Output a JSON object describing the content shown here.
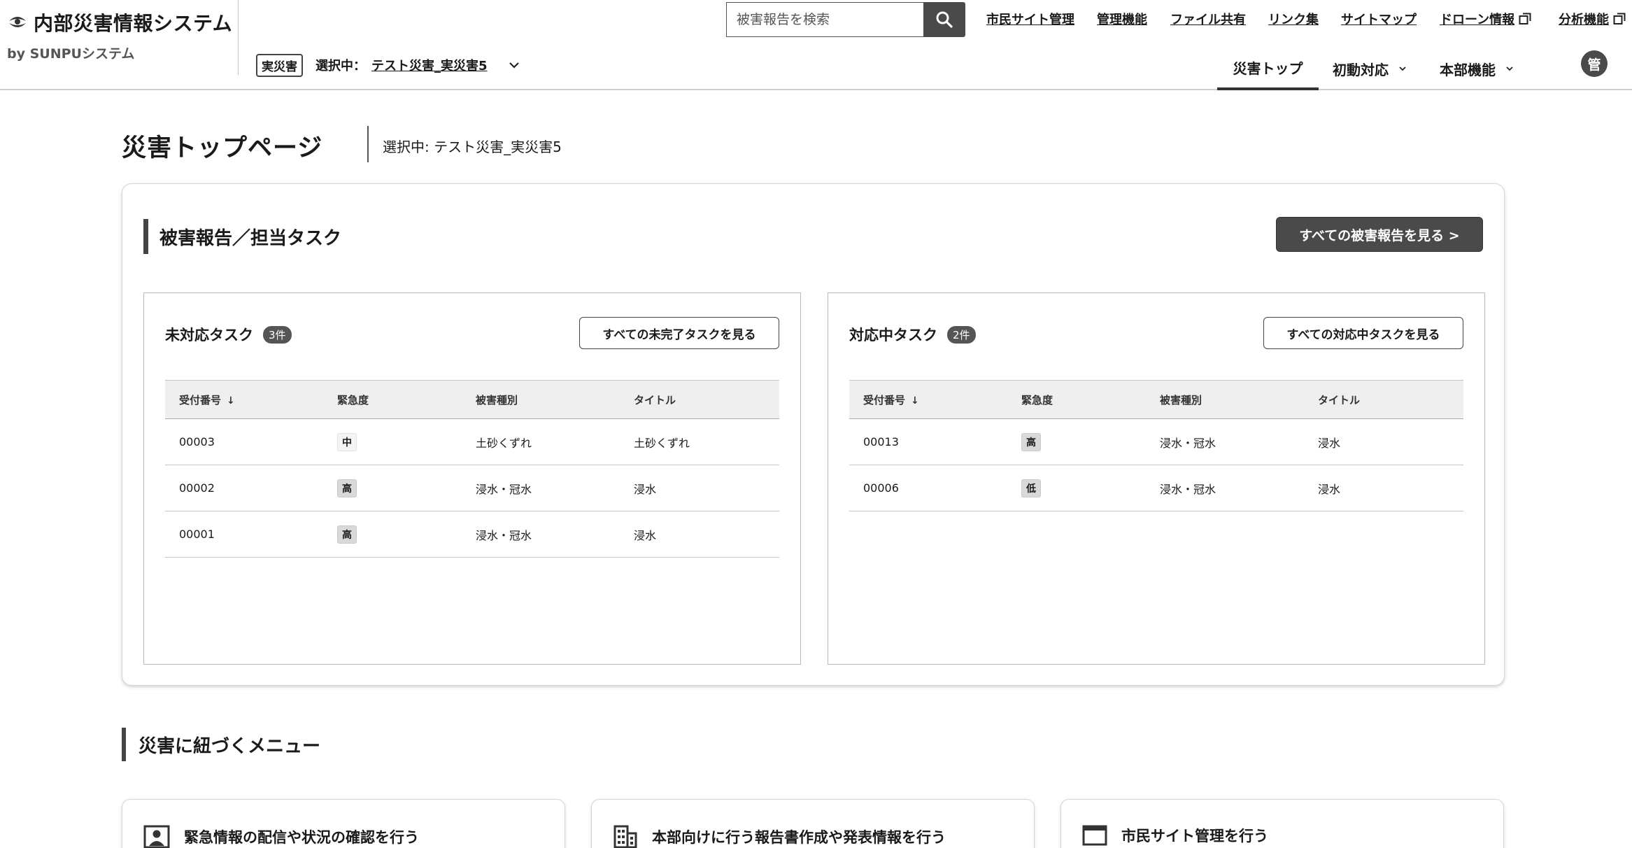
{
  "brand": {
    "title": "内部災害情報システム",
    "subtitle": "by SUNPUシステム"
  },
  "disaster_selector": {
    "tag": "実災害",
    "label": "選択中：",
    "value": "テスト災害_実災害5"
  },
  "search": {
    "placeholder": "被害報告を検索"
  },
  "top_links": [
    {
      "label": "市民サイト管理",
      "external": false
    },
    {
      "label": "管理機能",
      "external": false
    },
    {
      "label": "ファイル共有",
      "external": false
    },
    {
      "label": "リンク集",
      "external": false
    },
    {
      "label": "サイトマップ",
      "external": false
    },
    {
      "label": "ドローン情報",
      "external": true
    },
    {
      "label": "分析機能",
      "external": true
    }
  ],
  "main_nav": [
    {
      "label": "災害トップ",
      "active": true,
      "dropdown": false
    },
    {
      "label": "初動対応",
      "active": false,
      "dropdown": true
    },
    {
      "label": "本部機能",
      "active": false,
      "dropdown": true
    }
  ],
  "user": {
    "avatar": "管"
  },
  "page": {
    "title": "災害トップページ",
    "selected": "選択中: テスト災害_実災害5"
  },
  "reports_section": {
    "title": "被害報告／担当タスク",
    "all_button": "すべての被害報告を見る >"
  },
  "columns": [
    "受付番号",
    "緊急度",
    "被害種別",
    "タイトル"
  ],
  "sort_indicator": "↓",
  "unhandled": {
    "title": "未対応タスク",
    "count": "3件",
    "button": "すべての未完了タスクを見る",
    "rows": [
      {
        "id": "00003",
        "urgency": "中",
        "level": "mid",
        "type": "土砂くずれ",
        "title": "土砂くずれ"
      },
      {
        "id": "00002",
        "urgency": "高",
        "level": "high",
        "type": "浸水・冠水",
        "title": "浸水"
      },
      {
        "id": "00001",
        "urgency": "高",
        "level": "high",
        "type": "浸水・冠水",
        "title": "浸水"
      }
    ]
  },
  "in_progress": {
    "title": "対応中タスク",
    "count": "2件",
    "button": "すべての対応中タスクを見る",
    "rows": [
      {
        "id": "00013",
        "urgency": "高",
        "level": "high",
        "type": "浸水・冠水",
        "title": "浸水"
      },
      {
        "id": "00006",
        "urgency": "低",
        "level": "low",
        "type": "浸水・冠水",
        "title": "浸水"
      }
    ]
  },
  "menu_section": {
    "title": "災害に紐づくメニュー",
    "cards": [
      {
        "label": "緊急情報の配信や状況の確認を行う",
        "icon": "person-card-icon"
      },
      {
        "label": "本部向けに行う報告書作成や発表情報を行う",
        "icon": "building-icon"
      },
      {
        "label": "市民サイト管理を行う",
        "icon": "browser-window-icon"
      }
    ]
  },
  "colors": {
    "dark_button": "#4a4a4a",
    "border": "#d6d6d6",
    "table_header_bg": "#efefef"
  }
}
